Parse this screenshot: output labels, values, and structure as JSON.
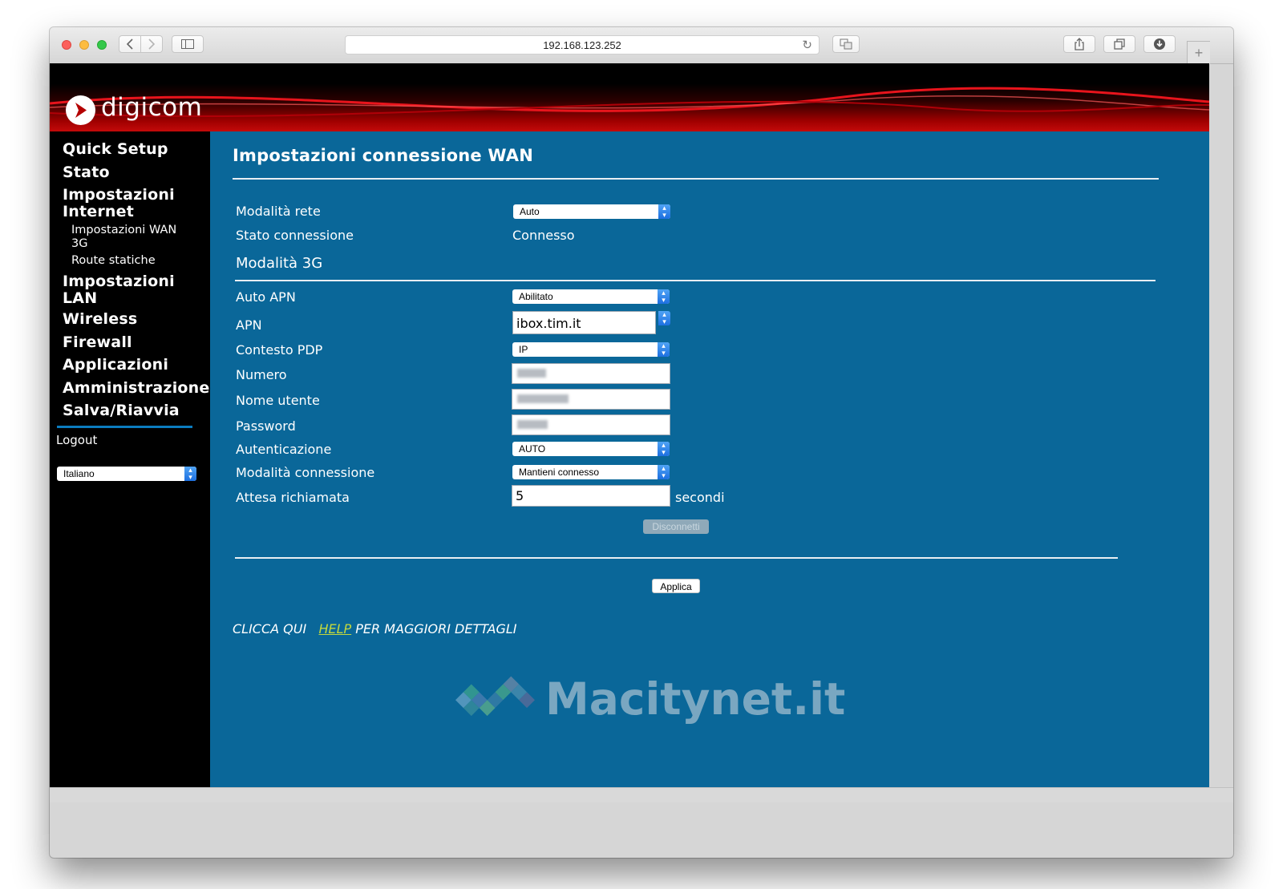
{
  "browser": {
    "url": "192.168.123.252"
  },
  "brand": {
    "logo_text": "digicom"
  },
  "sidebar": {
    "items": [
      {
        "label": "Quick Setup"
      },
      {
        "label": "Stato"
      },
      {
        "label": "Impostazioni Internet"
      },
      {
        "label": "Impostazioni LAN"
      },
      {
        "label": "Wireless"
      },
      {
        "label": "Firewall"
      },
      {
        "label": "Applicazioni"
      },
      {
        "label": "Amministrazione"
      },
      {
        "label": "Salva/Riavvia"
      }
    ],
    "sub_items": [
      {
        "label": "Impostazioni WAN 3G"
      },
      {
        "label": "Route statiche"
      }
    ],
    "logout": "Logout",
    "language": "Italiano"
  },
  "main": {
    "title": "Impostazioni connessione WAN",
    "modalita_rete": {
      "label": "Modalità rete",
      "value": "Auto"
    },
    "stato_connessione": {
      "label": "Stato connessione",
      "value": "Connesso"
    },
    "section_3g": "Modalità 3G",
    "auto_apn": {
      "label": "Auto APN",
      "value": "Abilitato"
    },
    "apn": {
      "label": "APN",
      "value": "ibox.tim.it"
    },
    "contesto_pdp": {
      "label": "Contesto PDP",
      "value": "IP"
    },
    "numero": {
      "label": "Numero"
    },
    "nome_utente": {
      "label": "Nome utente"
    },
    "password": {
      "label": "Password"
    },
    "autenticazione": {
      "label": "Autenticazione",
      "value": "AUTO"
    },
    "modalita_connessione": {
      "label": "Modalità connessione",
      "value": "Mantieni connesso"
    },
    "attesa_richiamata": {
      "label": "Attesa richiamata",
      "value": "5",
      "unit": "secondi"
    },
    "disconnect_button": "Disconnetti",
    "apply_button": "Applica",
    "help": {
      "prefix": "CLICCA QUI",
      "link": "HELP",
      "suffix": "PER MAGGIORI DETTAGLI"
    }
  },
  "watermark": {
    "text": "Macitynet.it"
  },
  "colors": {
    "page_background": "#0a6799",
    "sidebar_background": "#000000",
    "banner_red": "#c40a0a",
    "help_link": "#c3d83d"
  },
  "icons": [
    "back-icon",
    "forward-icon",
    "sidebar-toggle-icon",
    "reload-icon",
    "translate-icon",
    "share-icon",
    "tabs-icon",
    "download-icon",
    "new-tab-icon",
    "select-arrows-icon"
  ]
}
